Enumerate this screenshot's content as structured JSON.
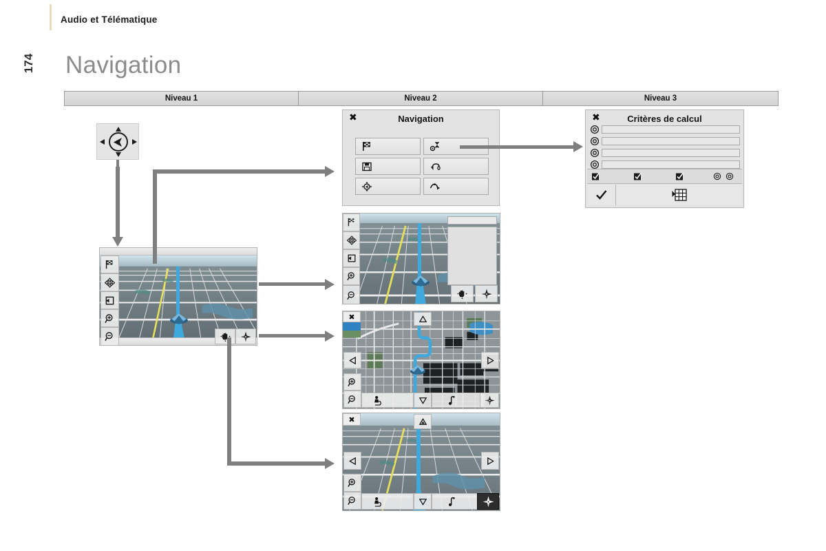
{
  "header": {
    "section_title": "Audio et Télématique",
    "page_number": "174",
    "page_heading": "Navigation"
  },
  "levels": {
    "columns": [
      {
        "label": "Niveau 1"
      },
      {
        "label": "Niveau 2"
      },
      {
        "label": "Niveau 3"
      }
    ]
  },
  "dpad": {
    "name": "joystick-control",
    "center_icon": "cursor-arrow-icon",
    "arrows": [
      "up",
      "right",
      "down",
      "left"
    ]
  },
  "navigation_menu": {
    "title": "Navigation",
    "close_label": "✖",
    "buttons": [
      {
        "icon": "checkered-flag-icon",
        "name": "destination-button"
      },
      {
        "icon": "route-criteria-icon",
        "name": "route-criteria-button"
      },
      {
        "icon": "floppy-disk-icon",
        "name": "save-destination-button"
      },
      {
        "icon": "traffic-info-icon",
        "name": "traffic-info-button"
      },
      {
        "icon": "compass-position-icon",
        "name": "current-position-button"
      },
      {
        "icon": "route-curve-icon",
        "name": "route-guidance-button"
      }
    ]
  },
  "criteria_panel": {
    "title": "Critères de calcul",
    "close_label": "✖",
    "rows": [
      {
        "radio": "radio-icon",
        "field_value": ""
      },
      {
        "radio": "radio-icon",
        "field_value": ""
      },
      {
        "radio": "radio-icon",
        "field_value": ""
      },
      {
        "radio": "radio-icon",
        "field_value": ""
      }
    ],
    "toolbar_icons": [
      "checkbox-checked-icon",
      "checkbox-checked-icon",
      "checkbox-checked-icon"
    ],
    "toolbar_radios": [
      "radio-icon",
      "radio-icon"
    ],
    "confirm_icon": "checkmark-icon",
    "keyboard_icon": "keypad-grid-icon"
  },
  "map_level1": {
    "name": "map-screen-3d-level1",
    "view": "3d-perspective",
    "left_controls": [
      "checkered-flag-icon",
      "pan-arrows-icon",
      "exit-arrow-icon",
      "zoom-in-icon",
      "zoom-out-icon"
    ],
    "bottom_right_controls": [
      "hand-pan-icon",
      "compass-rose-icon"
    ]
  },
  "map_level2_a": {
    "name": "map-screen-3d-with-list",
    "view": "3d-perspective",
    "left_controls": [
      "checkered-flag-icon",
      "pan-arrows-icon",
      "exit-arrow-icon",
      "zoom-in-icon",
      "zoom-out-icon"
    ],
    "side_field_value": "",
    "bottom_right_controls": [
      "hand-pan-icon",
      "compass-rose-icon"
    ]
  },
  "map_level2_b": {
    "name": "map-screen-2d-topdown",
    "view": "2d-topdown",
    "close_label": "✖",
    "left_controls": [
      "zoom-in-icon",
      "zoom-out-icon"
    ],
    "pan_controls": [
      "arrow-up-icon",
      "arrow-left-icon",
      "arrow-right-icon",
      "arrow-down-icon"
    ],
    "bottom_controls": [
      "poi-icon",
      "music-note-icon",
      "compass-rose-icon"
    ]
  },
  "map_level2_c": {
    "name": "map-screen-3d-panned",
    "view": "3d-perspective",
    "close_label": "✖",
    "left_controls": [
      "zoom-in-icon",
      "zoom-out-icon"
    ],
    "pan_controls": [
      "arrow-up-icon",
      "arrow-left-icon",
      "arrow-right-icon",
      "arrow-down-icon"
    ],
    "bottom_controls": [
      "poi-icon",
      "music-note-icon",
      "compass-rose-dark-icon"
    ]
  },
  "colors": {
    "connector": "#7f7f7f",
    "route_blue": "#3fa9dd",
    "road_yellow": "#e8e05a",
    "panel_bg": "#e3e3e3",
    "header_rule": "#e8dcc0",
    "heading_grey": "#8b8b8b"
  }
}
